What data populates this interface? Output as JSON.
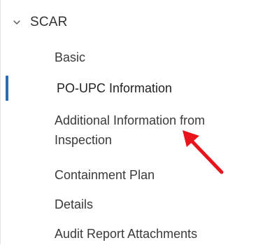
{
  "section": {
    "title": "SCAR",
    "chevron_icon": "chevron-down-icon"
  },
  "nav": {
    "items": [
      {
        "label": "Basic",
        "active": false
      },
      {
        "label": "PO-UPC Information",
        "active": true
      },
      {
        "label": "Additional Information from Inspection",
        "active": false
      },
      {
        "label": "Containment Plan",
        "active": false
      },
      {
        "label": "Details",
        "active": false
      },
      {
        "label": "Audit Report Attachments",
        "active": false
      }
    ]
  },
  "annotation": {
    "arrow_icon": "red-arrow-icon",
    "arrow_color": "#e8141c"
  },
  "colors": {
    "active_indicator": "#2b6cb0",
    "text": "#333333"
  }
}
